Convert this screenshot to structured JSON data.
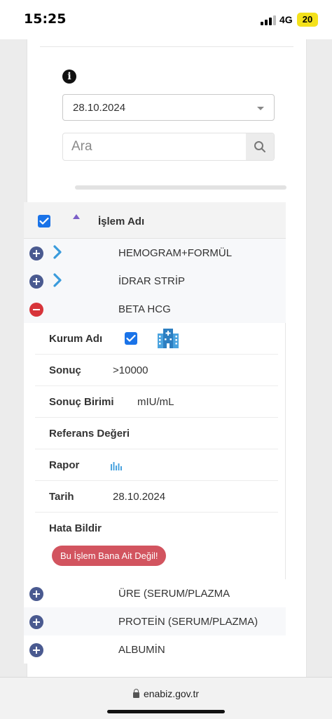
{
  "status_bar": {
    "time": "15:25",
    "network": "4G",
    "battery": "20"
  },
  "filters": {
    "date_value": "28.10.2024",
    "search_placeholder": "Ara"
  },
  "table": {
    "column_title": "İşlem Adı",
    "rows_before": [
      {
        "label": "HEMOGRAM+FORMÜL"
      },
      {
        "label": "İDRAR STRİP"
      }
    ],
    "expanded_row": {
      "label": "BETA HCG"
    },
    "details": {
      "institution_label": "Kurum Adı",
      "result_label": "Sonuç",
      "result_value": ">10000",
      "unit_label": "Sonuç Birimi",
      "unit_value": "mIU/mL",
      "reference_label": "Referans Değeri",
      "report_label": "Rapor",
      "date_label": "Tarih",
      "date_value": "28.10.2024",
      "report_error_label": "Hata Bildir",
      "not_mine_button": "Bu İşlem Bana Ait Değil!"
    },
    "rows_after": [
      {
        "label": "ÜRE (SERUM/PLAZMA"
      },
      {
        "label": "PROTEİN (SERUM/PLAZMA)"
      },
      {
        "label": "ALBUMİN"
      }
    ]
  },
  "address_bar": {
    "url": "enabiz.gov.tr"
  },
  "colors": {
    "accent_blue": "#1a73e8",
    "expand_plus": "#4a5a90",
    "collapse_minus": "#d7343a",
    "error_button": "#d2545f",
    "chevron": "#3a9bdc"
  }
}
